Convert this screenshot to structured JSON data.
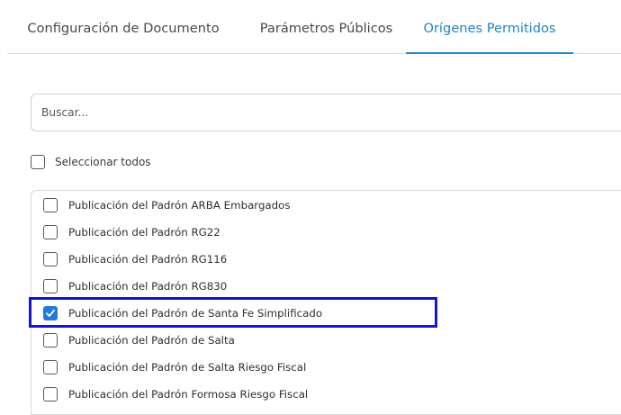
{
  "tabs": [
    {
      "label": "Configuración de Documento",
      "active": false
    },
    {
      "label": "Parámetros Públicos",
      "active": false
    },
    {
      "label": "Orígenes Permitidos",
      "active": true
    }
  ],
  "search": {
    "placeholder": "Buscar..."
  },
  "select_all": {
    "label": "Seleccionar todos",
    "checked": false
  },
  "items": [
    {
      "label": "Publicación del Padrón ARBA Embargados",
      "checked": false
    },
    {
      "label": "Publicación del Padrón RG22",
      "checked": false
    },
    {
      "label": "Publicación del Padrón RG116",
      "checked": false
    },
    {
      "label": "Publicación del Padrón RG830",
      "checked": false
    },
    {
      "label": "Publicación del Padrón de Santa Fe Simplificado",
      "checked": true
    },
    {
      "label": "Publicación del Padrón de Salta",
      "checked": false
    },
    {
      "label": "Publicación del Padrón de Salta Riesgo Fiscal",
      "checked": false
    },
    {
      "label": "Publicación del Padrón Formosa Riesgo Fiscal",
      "checked": false
    }
  ],
  "colors": {
    "accent": "#1f86c8",
    "checkbox_checked": "#1f7be0",
    "highlight_box": "#1414d6"
  }
}
